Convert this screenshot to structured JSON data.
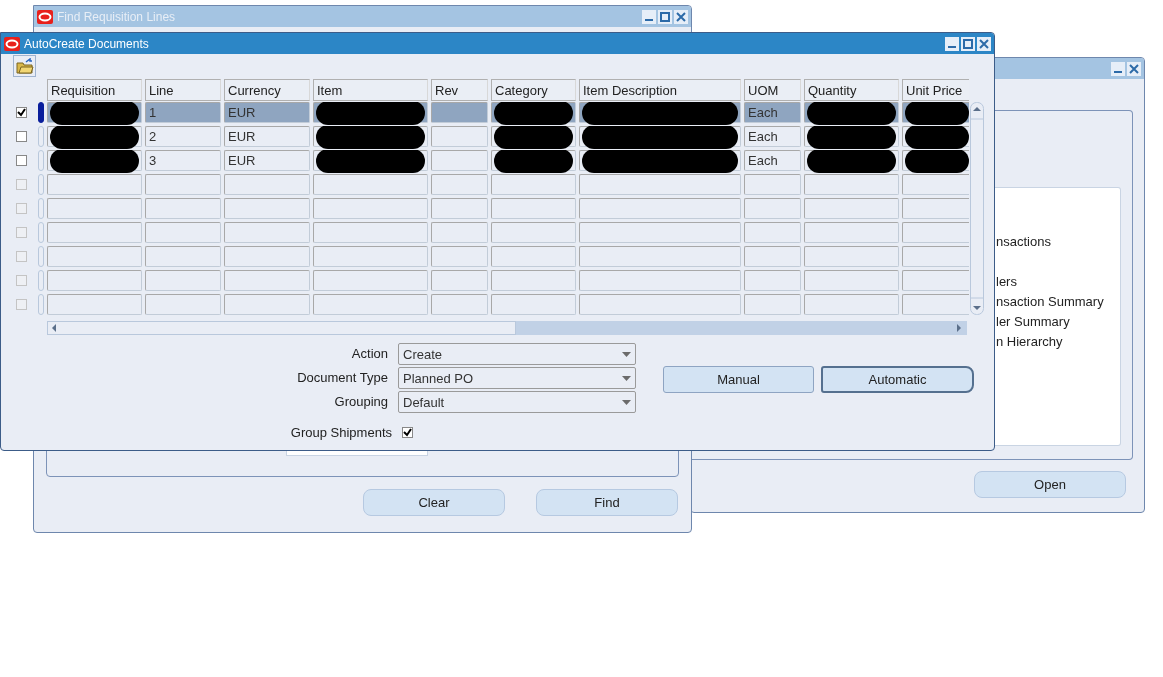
{
  "background_window": {
    "active": false,
    "items": [
      "nsactions",
      "lers",
      "nsaction Summary",
      "ler Summary",
      "n Hierarchy"
    ],
    "open_button": "Open"
  },
  "find_window": {
    "title": "Find Requisition Lines",
    "active": false,
    "buttons": [
      "Clear",
      "Find"
    ]
  },
  "autocreate_window": {
    "title": "AutoCreate Documents",
    "active": true,
    "columns": [
      "Requisition",
      "Line",
      "Currency",
      "Item",
      "Rev",
      "Category",
      "Item Description",
      "UOM",
      "Quantity",
      "Unit Price"
    ],
    "rows": [
      {
        "checked": true,
        "selected": true,
        "disabled": false,
        "cells": [
          {
            "redacted": true
          },
          {
            "text": "1"
          },
          {
            "text": "EUR"
          },
          {
            "redacted": true
          },
          {},
          {
            "redacted": true
          },
          {
            "redacted": true
          },
          {
            "text": "Each"
          },
          {
            "redacted": true
          },
          {
            "redacted": true
          }
        ]
      },
      {
        "checked": false,
        "selected": false,
        "disabled": false,
        "cells": [
          {
            "redacted": true
          },
          {
            "text": "2"
          },
          {
            "text": "EUR"
          },
          {
            "redacted": true
          },
          {},
          {
            "redacted": true
          },
          {
            "redacted": true
          },
          {
            "text": "Each"
          },
          {
            "redacted": true
          },
          {
            "redacted": true
          }
        ]
      },
      {
        "checked": false,
        "selected": false,
        "disabled": false,
        "cells": [
          {
            "redacted": true
          },
          {
            "text": "3"
          },
          {
            "text": "EUR"
          },
          {
            "redacted": true
          },
          {},
          {
            "redacted": true
          },
          {
            "redacted": true
          },
          {
            "text": "Each"
          },
          {
            "redacted": true
          },
          {
            "redacted": true
          }
        ]
      },
      {
        "checked": false,
        "selected": false,
        "disabled": true
      },
      {
        "checked": false,
        "selected": false,
        "disabled": true
      },
      {
        "checked": false,
        "selected": false,
        "disabled": true
      },
      {
        "checked": false,
        "selected": false,
        "disabled": true
      },
      {
        "checked": false,
        "selected": false,
        "disabled": true
      },
      {
        "checked": false,
        "selected": false,
        "disabled": true
      }
    ],
    "fields": [
      {
        "label": "Action",
        "value": "Create"
      },
      {
        "label": "Document Type",
        "value": "Planned PO"
      },
      {
        "label": "Grouping",
        "value": "Default"
      }
    ],
    "buttons": [
      {
        "label": "Manual",
        "focused": false
      },
      {
        "label": "Automatic",
        "focused": true
      }
    ],
    "group_shipments": {
      "label": "Group Shipments",
      "checked": true
    }
  }
}
